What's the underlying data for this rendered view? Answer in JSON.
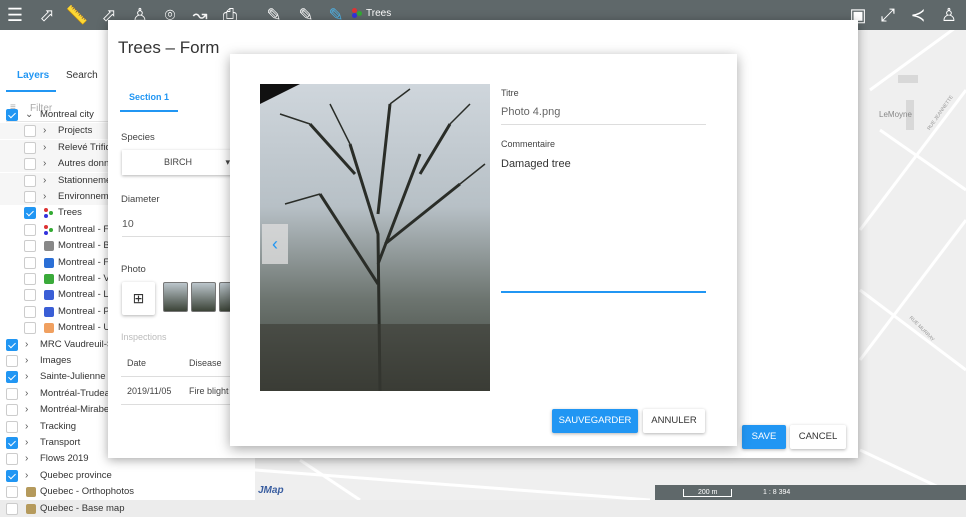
{
  "toolbar": {
    "icons": [
      "menu-icon",
      "select-arrow-icon",
      "measure-ruler-icon",
      "identify-icon",
      "person-icon",
      "location-pin-icon",
      "route-icon",
      "print-icon",
      "edit-pencil-icon",
      "add-pencil-icon",
      "pencil-question-icon"
    ],
    "active_layer": "Trees",
    "right_icons": [
      "minimize-icon",
      "fullscreen-icon",
      "share-icon",
      "user-icon"
    ]
  },
  "left_panel": {
    "tabs": [
      "Layers",
      "Search"
    ],
    "filter_placeholder": "Filter",
    "layers": [
      {
        "label": "Montreal city",
        "checked": true,
        "level": 0,
        "expand": "down"
      },
      {
        "label": "Projects",
        "checked": false,
        "level": 1,
        "expand": "right"
      },
      {
        "label": "Relevé Trifide",
        "checked": false,
        "level": 1,
        "expand": "right"
      },
      {
        "label": "Autres donne",
        "checked": false,
        "level": 1,
        "expand": "right"
      },
      {
        "label": "Stationneme",
        "checked": false,
        "level": 1,
        "expand": "right"
      },
      {
        "label": "Environneme",
        "checked": false,
        "level": 1,
        "expand": "right"
      },
      {
        "label": "Trees",
        "checked": true,
        "level": 1,
        "icon": "dots"
      },
      {
        "label": "Montreal - Fi",
        "checked": false,
        "level": 1,
        "icon": "dots"
      },
      {
        "label": "Montreal - B",
        "checked": false,
        "level": 1,
        "icon": "bike",
        "color": "#888888"
      },
      {
        "label": "Montreal - Fi",
        "checked": false,
        "level": 1,
        "icon": "marker",
        "color": "#2b6fd6"
      },
      {
        "label": "Montreal - V",
        "checked": false,
        "level": 1,
        "icon": "square",
        "color": "#3aaa3a"
      },
      {
        "label": "Montreal - La",
        "checked": false,
        "level": 1,
        "icon": "square",
        "color": "#3a5ed6"
      },
      {
        "label": "Montreal - Po",
        "checked": false,
        "level": 1,
        "icon": "shield",
        "color": "#3a5ed6"
      },
      {
        "label": "Montreal - U",
        "checked": false,
        "level": 1,
        "icon": "square",
        "color": "#f0a060"
      },
      {
        "label": "MRC Vaudreuil-S",
        "checked": true,
        "level": 0,
        "expand": "right"
      },
      {
        "label": "Images",
        "checked": false,
        "level": 0,
        "expand": "right"
      },
      {
        "label": "Sainte-Julienne c",
        "checked": true,
        "level": 0,
        "expand": "right"
      },
      {
        "label": "Montréal-Trudeau",
        "checked": false,
        "level": 0,
        "expand": "right"
      },
      {
        "label": "Montréal-Mirabel",
        "checked": false,
        "level": 0,
        "expand": "right"
      },
      {
        "label": "Tracking",
        "checked": false,
        "level": 0,
        "expand": "right"
      },
      {
        "label": "Transport",
        "checked": true,
        "level": 0,
        "expand": "right"
      },
      {
        "label": "Flows 2019",
        "checked": false,
        "level": 0,
        "expand": "right"
      },
      {
        "label": "Quebec province",
        "checked": true,
        "level": 0,
        "expand": "right"
      },
      {
        "label": "Quebec - Orthophotos",
        "checked": false,
        "level": 0,
        "icon": "map",
        "color": "#b59a5c"
      },
      {
        "label": "Quebec - Base map",
        "checked": false,
        "level": 0,
        "icon": "map",
        "color": "#b59a5c"
      }
    ]
  },
  "form": {
    "title": "Trees – Form",
    "section_tab": "Section 1",
    "species_label": "Species",
    "species_value": "BIRCH",
    "diameter_label": "Diameter",
    "diameter_value": "10",
    "photo_label": "Photo",
    "inspections_label": "Inspections",
    "table": {
      "headers": [
        "Date",
        "Disease"
      ],
      "rows": [
        [
          "2019/11/05",
          "Fire blight"
        ]
      ]
    },
    "save": "SAVE",
    "cancel": "CANCEL"
  },
  "photo_dialog": {
    "title_label": "Titre",
    "title_value": "Photo 4.png",
    "comment_label": "Commentaire",
    "comment_value": "Damaged tree",
    "save": "SAUVEGARDER",
    "cancel": "ANNULER"
  },
  "map": {
    "labels": [
      "LeMoyne",
      "RUE JEANNETTE",
      "RUE MURRAY"
    ],
    "scale_bar": "200 m",
    "scale_ratio": "1 : 8 394",
    "logo": "JMap"
  },
  "colors": {
    "accent": "#2196f3",
    "toolbar": "#5f686a"
  }
}
